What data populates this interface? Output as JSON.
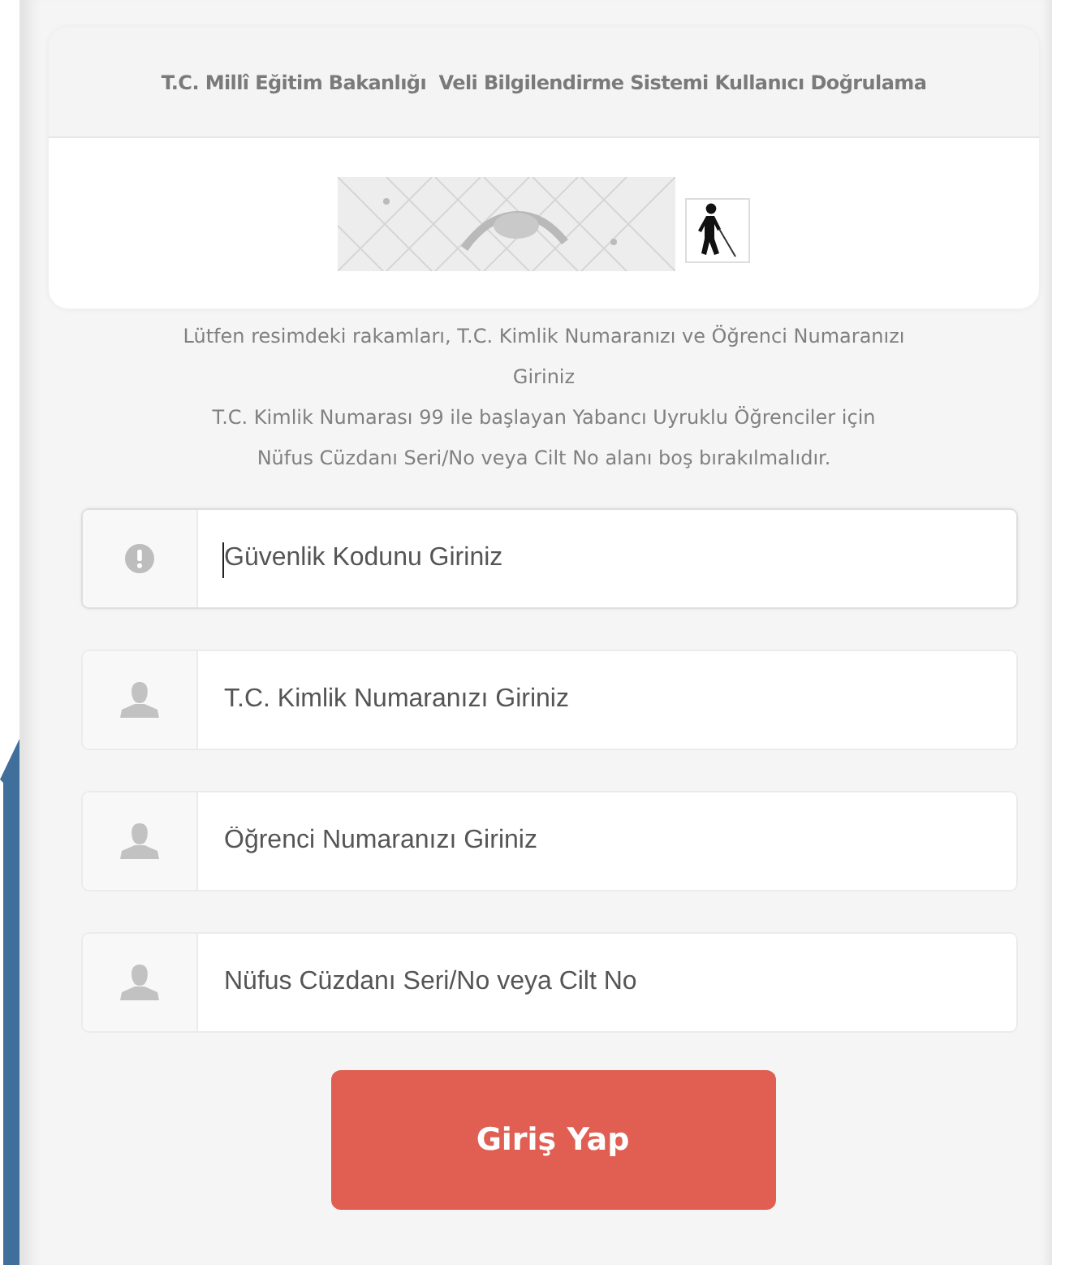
{
  "header": {
    "title": "T.C. Millî Eğitim Bakanlığı  Veli Bilgilendirme Sistemi Kullanıcı Doğrulama"
  },
  "instructions": [
    "Lütfen resimdeki rakamları, T.C. Kimlik Numaranızı ve Öğrenci Numaranızı Giriniz",
    "T.C. Kimlik Numarası 99 ile başlayan Yabancı Uyruklu Öğrenciler için Nüfus Cüzdanı Seri/No veya Cilt No alanı boş bırakılmalıdır."
  ],
  "fields": [
    {
      "kind": "alert",
      "placeholder": "Güvenlik Kodunu Giriniz",
      "focused": true
    },
    {
      "kind": "user",
      "placeholder": "T.C. Kimlik Numaranızı Giriniz",
      "focused": false
    },
    {
      "kind": "user",
      "placeholder": "Öğrenci Numaranızı Giriniz",
      "focused": false
    },
    {
      "kind": "user",
      "placeholder": "Nüfus Cüzdanı Seri/No veya Cilt No",
      "focused": false
    }
  ],
  "submit": {
    "label": "Giriş Yap"
  }
}
